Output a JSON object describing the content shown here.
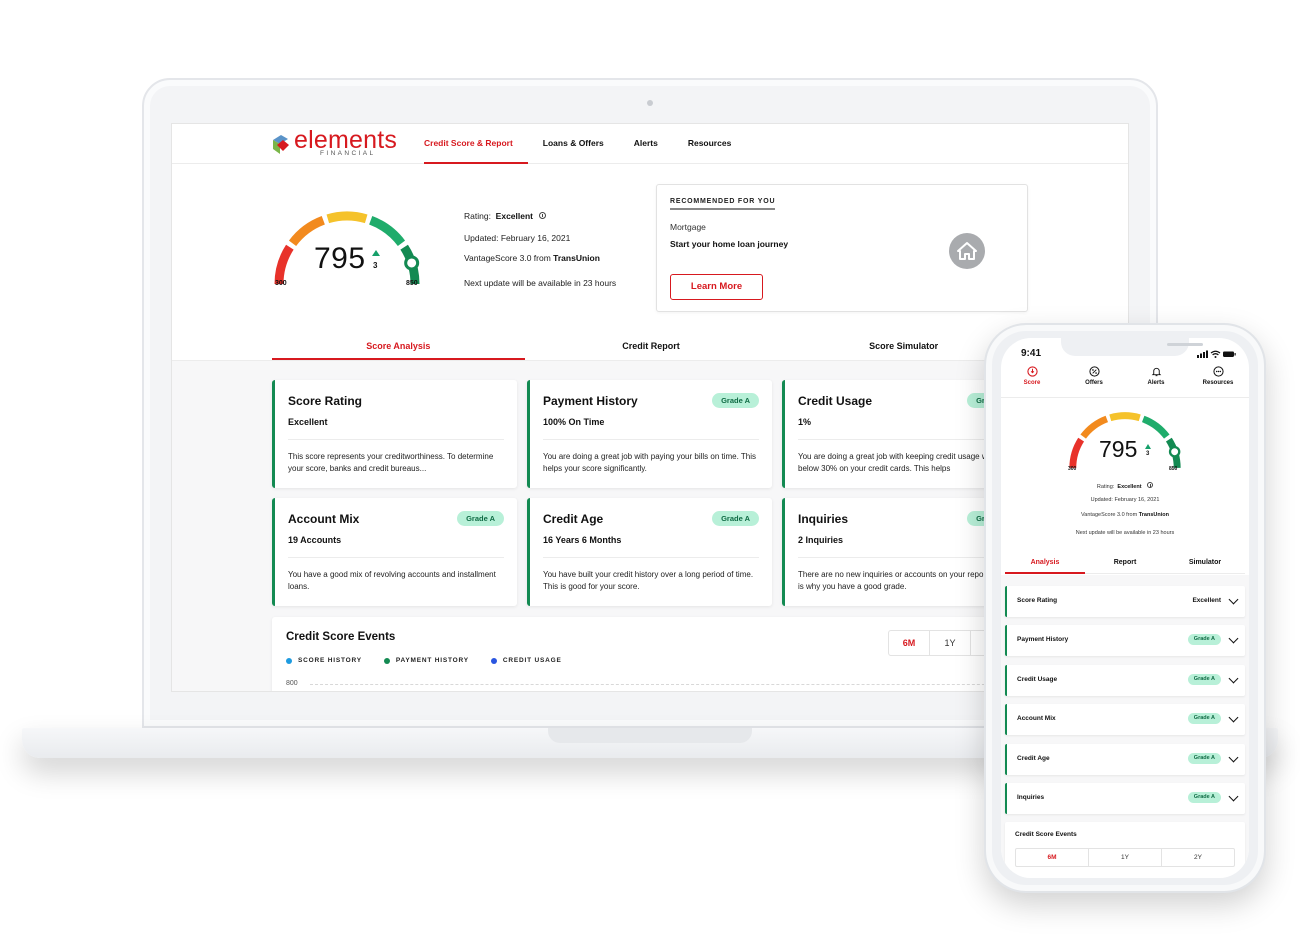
{
  "brand": {
    "name": "elements",
    "subtitle": "FINANCIAL",
    "colors": {
      "red": "#d7191f",
      "green": "#138a52",
      "badge_bg": "#b8f0d8",
      "badge_text": "#0f6b44",
      "blue_tile": "#5a93c8",
      "green_tile": "#7ab648"
    }
  },
  "nav": {
    "items": [
      {
        "label": "Credit Score & Report",
        "active": true
      },
      {
        "label": "Loans & Offers",
        "active": false
      },
      {
        "label": "Alerts",
        "active": false
      },
      {
        "label": "Resources",
        "active": false
      }
    ]
  },
  "score": {
    "value": "795",
    "delta": "3",
    "delta_direction": "up",
    "min_label": "300",
    "max_label": "850",
    "min": 300,
    "max": 850,
    "gauge_fraction": 0.9,
    "segment_colors": [
      "#e8322a",
      "#f28a1e",
      "#f5c22b",
      "#1fac6b",
      "#138a52"
    ],
    "rating_label": "Rating:",
    "rating": "Excellent",
    "updated_label": "Updated: February 16, 2021",
    "source_prefix": "VantageScore 3.0 from",
    "source": "TransUnion",
    "next_update": "Next update will be available in 23 hours"
  },
  "recommended": {
    "title": "RECOMMENDED FOR YOU",
    "category": "Mortgage",
    "headline": "Start your home loan journey",
    "button": "Learn More",
    "icon": "home-icon"
  },
  "tabs": [
    {
      "label": "Score Analysis",
      "active": true
    },
    {
      "label": "Credit Report",
      "active": false
    },
    {
      "label": "Score Simulator",
      "active": false
    }
  ],
  "cards": [
    {
      "title": "Score Rating",
      "badge": "",
      "value": "Excellent",
      "desc": "This score represents your creditworthiness. To determine your score, banks and credit bureaus..."
    },
    {
      "title": "Payment History",
      "badge": "Grade A",
      "value": "100% On Time",
      "desc": "You are doing a great job with paying your bills on time. This helps your score significantly."
    },
    {
      "title": "Credit Usage",
      "badge": "Grade A",
      "value": "1%",
      "desc": "You are doing a great job with keeping credit usage well below 30% on your credit cards. This helps"
    },
    {
      "title": "Account Mix",
      "badge": "Grade A",
      "value": "19 Accounts",
      "desc": "You have a good mix of revolving accounts and installment loans."
    },
    {
      "title": "Credit Age",
      "badge": "Grade A",
      "value": "16 Years 6 Months",
      "desc": "You have built your credit history over a long period of time. This is good for your score."
    },
    {
      "title": "Inquiries",
      "badge": "Grade A",
      "value": "2 Inquiries",
      "desc": "There are no new inquiries or accounts on your report, which is why you have a good grade."
    }
  ],
  "events": {
    "title": "Credit Score Events",
    "legend": [
      {
        "label": "SCORE HISTORY",
        "color": "#1e9be0"
      },
      {
        "label": "PAYMENT HISTORY",
        "color": "#138a52"
      },
      {
        "label": "CREDIT USAGE",
        "color": "#2a55e0"
      }
    ],
    "ranges": [
      {
        "label": "6M",
        "active": true
      },
      {
        "label": "1Y",
        "active": false
      },
      {
        "label": "2Y",
        "active": false
      }
    ],
    "y_tick": "800"
  },
  "phone": {
    "time": "9:41",
    "nav": [
      {
        "label": "Score",
        "icon": "score-icon",
        "active": true
      },
      {
        "label": "Offers",
        "icon": "percent-icon",
        "active": false
      },
      {
        "label": "Alerts",
        "icon": "bell-icon",
        "active": false
      },
      {
        "label": "Resources",
        "icon": "more-icon",
        "active": false
      }
    ],
    "tabs": [
      {
        "label": "Analysis",
        "active": true
      },
      {
        "label": "Report",
        "active": false
      },
      {
        "label": "Simulator",
        "active": false
      }
    ],
    "rows": [
      {
        "label": "Score Rating",
        "value": "Excellent",
        "badge": ""
      },
      {
        "label": "Payment History",
        "value": "",
        "badge": "Grade A"
      },
      {
        "label": "Credit Usage",
        "value": "",
        "badge": "Grade A"
      },
      {
        "label": "Account Mix",
        "value": "",
        "badge": "Grade A"
      },
      {
        "label": "Credit Age",
        "value": "",
        "badge": "Grade A"
      },
      {
        "label": "Inquiries",
        "value": "",
        "badge": "Grade A"
      }
    ],
    "events_title": "Credit Score Events",
    "ranges": [
      {
        "label": "6M",
        "active": true
      },
      {
        "label": "1Y",
        "active": false
      },
      {
        "label": "2Y",
        "active": false
      }
    ]
  }
}
